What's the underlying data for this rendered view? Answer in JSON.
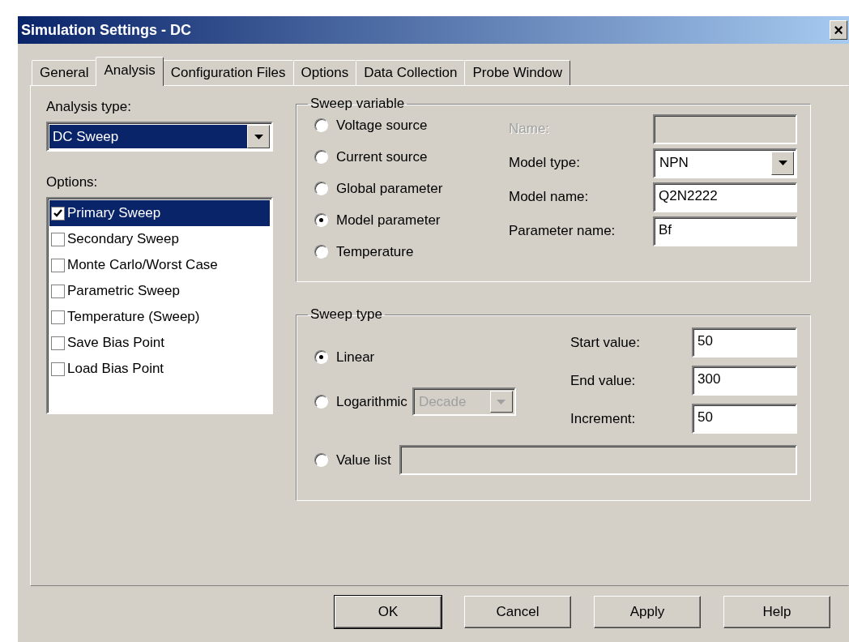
{
  "window": {
    "title": "Simulation Settings - DC",
    "close_label": "×"
  },
  "tabs": [
    {
      "label": "General",
      "selected": false
    },
    {
      "label": "Analysis",
      "selected": true
    },
    {
      "label": "Configuration Files",
      "selected": false
    },
    {
      "label": "Options",
      "selected": false
    },
    {
      "label": "Data Collection",
      "selected": false
    },
    {
      "label": "Probe Window",
      "selected": false
    }
  ],
  "analysis_type": {
    "label": "Analysis type:",
    "value": "DC Sweep"
  },
  "options": {
    "label": "Options:",
    "items": [
      {
        "label": "Primary Sweep",
        "checked": true,
        "selected": true
      },
      {
        "label": "Secondary Sweep",
        "checked": false,
        "selected": false
      },
      {
        "label": "Monte Carlo/Worst Case",
        "checked": false,
        "selected": false
      },
      {
        "label": "Parametric Sweep",
        "checked": false,
        "selected": false
      },
      {
        "label": "Temperature (Sweep)",
        "checked": false,
        "selected": false
      },
      {
        "label": "Save Bias Point",
        "checked": false,
        "selected": false
      },
      {
        "label": "Load Bias Point",
        "checked": false,
        "selected": false
      }
    ]
  },
  "sweep_variable": {
    "title": "Sweep variable",
    "radios": [
      {
        "label": "Voltage source",
        "selected": false
      },
      {
        "label": "Current source",
        "selected": false
      },
      {
        "label": "Global parameter",
        "selected": false
      },
      {
        "label": "Model parameter",
        "selected": true
      },
      {
        "label": "Temperature",
        "selected": false
      }
    ],
    "fields": [
      {
        "kind": "text",
        "label": "Name:",
        "disabled": true
      },
      {
        "kind": "dropdown",
        "label": "Model type:",
        "value": "NPN",
        "disabled": false
      },
      {
        "kind": "text",
        "label": "Model name:",
        "value": "Q2N2222",
        "disabled": false
      },
      {
        "kind": "text",
        "label": "Parameter name:",
        "value": "Bf",
        "disabled": false
      }
    ]
  },
  "sweep_type": {
    "title": "Sweep type",
    "linear": {
      "label": "Linear",
      "selected": true
    },
    "logarithmic": {
      "label": "Logarithmic",
      "selected": false,
      "scale": {
        "value": "Decade",
        "disabled": true
      }
    },
    "value_list": {
      "label": "Value list",
      "selected": false,
      "disabled": true
    },
    "fields": [
      {
        "label": "Start value:",
        "value": "50"
      },
      {
        "label": "End value:",
        "value": "300"
      },
      {
        "label": "Increment:",
        "value": "50"
      }
    ]
  },
  "buttons": [
    {
      "label": "OK",
      "default": true
    },
    {
      "label": "Cancel",
      "default": false
    },
    {
      "label": "Apply",
      "default": false
    },
    {
      "label": "Help",
      "default": false
    }
  ]
}
